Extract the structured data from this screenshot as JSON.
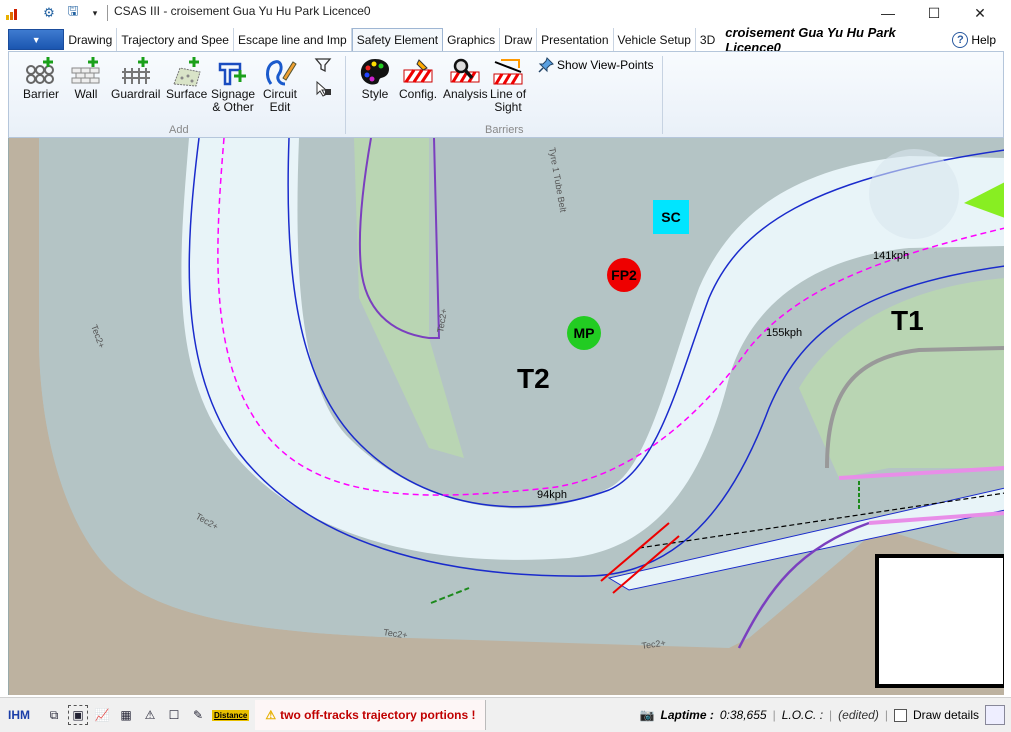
{
  "window": {
    "title": "CSAS III - croisement Gua Yu Hu Park Licence0",
    "controls": {
      "minimize": "—",
      "maximize": "☐",
      "close": "✕"
    }
  },
  "tabs": {
    "items": [
      "Drawing",
      "Trajectory and Spee",
      "Escape line and Imp",
      "Safety Element",
      "Graphics",
      "Draw",
      "Presentation",
      "Vehicle Setup",
      "3D"
    ],
    "active": "Safety Element",
    "project_title": "croisement Gua Yu Hu Park Licence0",
    "help": "Help"
  },
  "ribbon": {
    "add": {
      "label": "Add",
      "barrier": "Barrier",
      "wall": "Wall",
      "guardrail": "Guardrail",
      "surface": "Surface",
      "signage_line1": "Signage",
      "signage_line2": "& Other",
      "circuit_line1": "Circuit",
      "circuit_line2": "Edit"
    },
    "barriers": {
      "label": "Barriers",
      "style": "Style",
      "config": "Config.",
      "analysis": "Analysis",
      "los_line1": "Line of",
      "los_line2": "Sight",
      "show_viewpoints": "Show View-Points"
    }
  },
  "map": {
    "labels": {
      "t1": "T1",
      "t2": "T2",
      "sc": "SC",
      "fp2": "FP2",
      "mp": "MP",
      "speed_94": "94kph",
      "speed_155": "155kph",
      "speed_141": "141kph",
      "tyre": "Tyre 1 Tube Belt",
      "tec_a": "Tec2+",
      "tec_b": "Tec2+",
      "tec_c": "Tec2+",
      "tec_d": "Tec2+",
      "tec_e": "Tec2+"
    },
    "colors": {
      "runoff": "#b4c4c5",
      "grass": "#b9d5b3",
      "track": "#e8f4f8",
      "gravel": "#bdb2a0",
      "trajectory": "#ff00ff",
      "barrier_line": "#7b3fbf",
      "edge_line": "#1a2bcc",
      "sc_marker": "#00e5ff",
      "fp_marker": "#ee0000",
      "mp_marker": "#22cc22"
    }
  },
  "status": {
    "ihm": "IHM",
    "distance": "Distance",
    "warning": "two off-tracks trajectory portions !",
    "laptime_label": "Laptime :",
    "laptime_value": "0:38,655",
    "loc_label": "L.O.C. :",
    "edited": "(edited)",
    "draw_details": "Draw details"
  }
}
